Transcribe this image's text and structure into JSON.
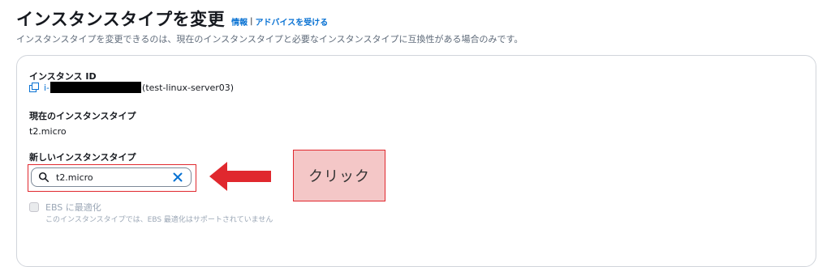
{
  "header": {
    "title": "インスタンスタイプを変更",
    "info_link": "情報",
    "separator": "|",
    "advice_link": "アドバイスを受ける",
    "description": "インスタンスタイプを変更できるのは、現在のインスタンスタイプと必要なインスタンスタイプに互換性がある場合のみです。"
  },
  "instance_id": {
    "label": "インスタンス ID",
    "prefix": "i-",
    "name": "(test-linux-server03)"
  },
  "current_type": {
    "label": "現在のインスタンスタイプ",
    "value": "t2.micro"
  },
  "new_type": {
    "label": "新しいインスタンスタイプ",
    "value": "t2.micro"
  },
  "annotation": {
    "callout_text": "クリック",
    "accent_color": "#e0282e"
  },
  "ebs": {
    "label": "EBS に最適化",
    "description": "このインスタンスタイプでは、EBS 最適化はサポートされていません"
  },
  "icons": {
    "copy": "copy-icon",
    "search": "search-icon",
    "clear": "close-icon"
  },
  "colors": {
    "link": "#0972d3",
    "text": "#16191f",
    "muted": "#5f6b7a",
    "disabled": "#9ba7b6",
    "callout_bg": "#f4c7c7"
  }
}
